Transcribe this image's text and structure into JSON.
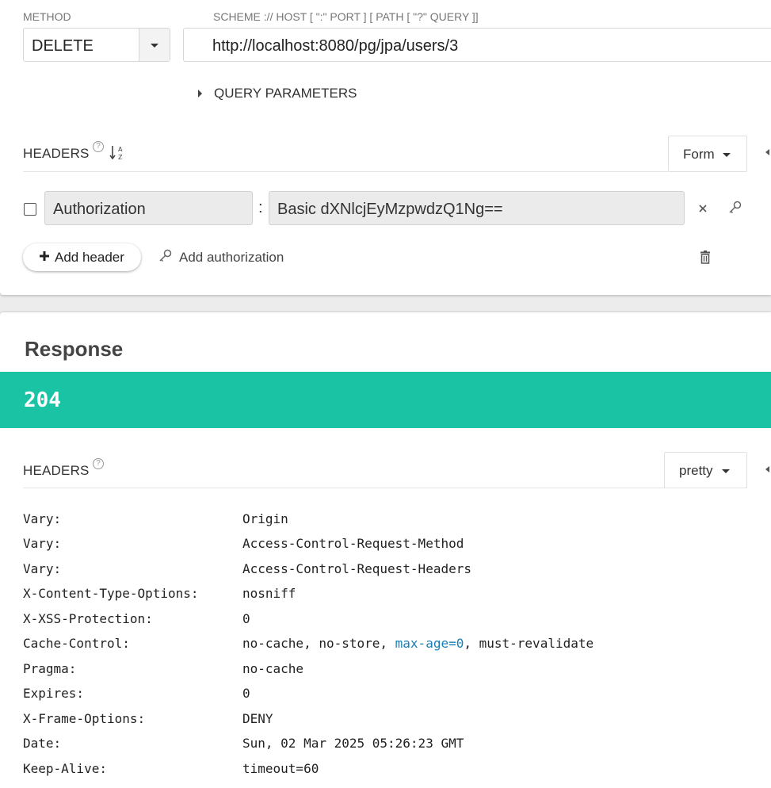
{
  "request": {
    "method_label": "METHOD",
    "url_label": "SCHEME :// HOST [ \":\" PORT ] [ PATH [ \"?\" QUERY ]]",
    "method": "DELETE",
    "url": "http://localhost:8080/pg/jpa/users/3",
    "query_parameters_label": "QUERY PARAMETERS",
    "headers": {
      "title": "HEADERS",
      "help_icon": "question-circle-icon",
      "sort_icon": "sort-alpha-icon",
      "mode": "Form",
      "rows": [
        {
          "name": "Authorization",
          "separator": ":",
          "value": "Basic dXNlcjEyMzpwdzQ1Ng==",
          "checked": false
        }
      ],
      "add_header_label": "Add header",
      "add_authorization_label": "Add authorization"
    }
  },
  "response": {
    "title": "Response",
    "status_code": "204",
    "status_color": "#1bc3a5",
    "headers_title": "HEADERS",
    "view_mode": "pretty",
    "headers": [
      {
        "name": "Vary:",
        "value": "Origin"
      },
      {
        "name": "Vary:",
        "value": "Access-Control-Request-Method"
      },
      {
        "name": "Vary:",
        "value": "Access-Control-Request-Headers"
      },
      {
        "name": "X-Content-Type-Options:",
        "value": "nosniff"
      },
      {
        "name": "X-XSS-Protection:",
        "value": "0"
      },
      {
        "name": "Cache-Control:",
        "value_parts": [
          "no-cache, no-store, ",
          "max-age=0",
          ", must-revalidate"
        ]
      },
      {
        "name": "Pragma:",
        "value": "no-cache"
      },
      {
        "name": "Expires:",
        "value": "0"
      },
      {
        "name": "X-Frame-Options:",
        "value": "DENY"
      },
      {
        "name": "Date:",
        "value": "Sun, 02 Mar 2025 05:26:23 GMT"
      },
      {
        "name": "Keep-Alive:",
        "value": "timeout=60"
      }
    ]
  }
}
